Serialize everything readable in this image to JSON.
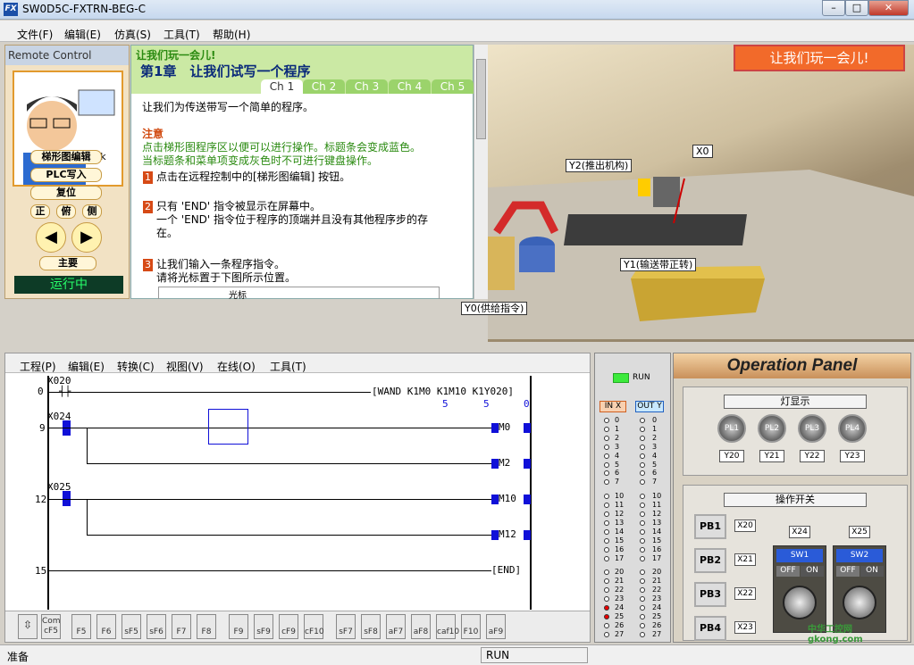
{
  "window": {
    "title": "SW0D5C-FXTRN-BEG-C",
    "logo": "FX"
  },
  "menu": [
    "文件(F)",
    "编辑(E)",
    "仿真(S)",
    "工具(T)",
    "帮助(H)"
  ],
  "remote": {
    "header": "Remote Control",
    "click": "click",
    "btn_ladder": "梯形图编辑",
    "btn_plc": "PLC写入",
    "btn_reset": "复位",
    "view_front": "正",
    "view_top": "俯",
    "view_side": "侧",
    "btn_main": "主要",
    "running": "运行中"
  },
  "tutorial": {
    "banner": "让我们玩一会儿!",
    "chapter": "第1章　让我们试写一个程序",
    "tabs": [
      "Ch 1",
      "Ch 2",
      "Ch 3",
      "Ch 4",
      "Ch 5"
    ],
    "intro": "让我们为传送带写一个简单的程序。",
    "note_title": "注意",
    "note1": "点击梯形图程序区以便可以进行操作。标题条会变成蓝色。",
    "note2": "当标题条和菜单项变成灰色时不可进行键盘操作。",
    "step1": "点击在远程控制中的[梯形图编辑] 按钮。",
    "step2a": "只有 'END' 指令被显示在屏幕中。",
    "step2b": "一个 'END' 指令位于程序的顶端并且没有其他程序步的存",
    "step2c": "在。",
    "step3a": "让我们输入一条程序指令。",
    "step3b": "请将光标置于下图所示位置。",
    "step3c": "光标"
  },
  "scene": {
    "play_button": "让我们玩一会儿!",
    "labels": {
      "x0": "X0",
      "y2": "Y2(推出机构)",
      "y1": "Y1(输送带正转)",
      "y0": "Y0(供给指令)"
    }
  },
  "ladder": {
    "menu": [
      "工程(P)",
      "编辑(E)",
      "转换(C)",
      "视图(V)",
      "在线(O)",
      "工具(T)"
    ],
    "rows": [
      {
        "step": "0",
        "contact": "X020",
        "instr": "[WAND  K1M0   K1M10  K1Y020]",
        "sub": [
          "5",
          "5",
          "0"
        ]
      },
      {
        "step": "9",
        "contact": "X024",
        "coil": "M0"
      },
      {
        "coil": "M2"
      },
      {
        "step": "12",
        "contact": "X025",
        "coil": "M10"
      },
      {
        "coil": "M12"
      },
      {
        "step": "15",
        "instr": "[END]"
      }
    ],
    "fkeys": [
      "F5",
      "F6",
      "sF5",
      "sF6",
      "F7",
      "F8",
      "F9",
      "sF9",
      "cF9",
      "cF10",
      "sF7",
      "sF8",
      "aF7",
      "aF8",
      "caf10",
      "F10",
      "aF9"
    ],
    "com": "Com\ncF5"
  },
  "io": {
    "run": "RUN",
    "in_header": "IN X",
    "out_header": "OUT Y",
    "labels": [
      "0",
      "1",
      "2",
      "3",
      "4",
      "5",
      "6",
      "7",
      "10",
      "11",
      "12",
      "13",
      "14",
      "15",
      "16",
      "17",
      "20",
      "21",
      "22",
      "23",
      "24",
      "25",
      "26",
      "27"
    ],
    "in_on": [
      "24",
      "25"
    ],
    "out_on": []
  },
  "op": {
    "title": "Operation Panel",
    "lights_title": "灯显示",
    "lights": [
      "PL1",
      "PL2",
      "PL3",
      "PL4"
    ],
    "light_addr": [
      "Y20",
      "Y21",
      "Y22",
      "Y23"
    ],
    "switch_title": "操作开关",
    "pbs": [
      "PB1",
      "PB2",
      "PB3",
      "PB4"
    ],
    "pb_addr": [
      "X20",
      "X21",
      "X22",
      "X23"
    ],
    "sw": [
      {
        "addr": "X24",
        "name": "SW1"
      },
      {
        "addr": "X25",
        "name": "SW2"
      }
    ],
    "off": "OFF",
    "on": "ON"
  },
  "status": {
    "left": "准备",
    "mode": "RUN"
  },
  "watermark": "中华工控网 gkong.com"
}
